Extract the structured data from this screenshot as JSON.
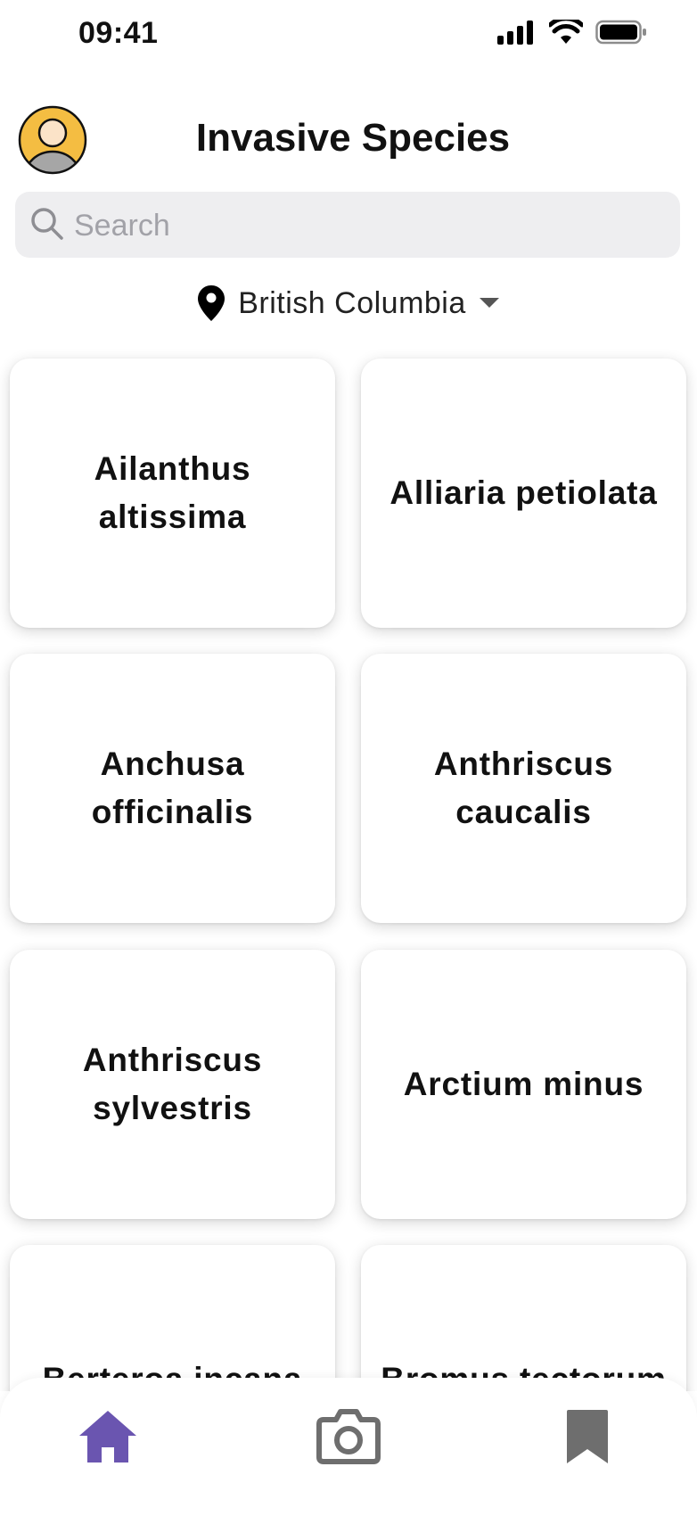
{
  "status_bar": {
    "time": "09:41"
  },
  "header": {
    "title": "Invasive Species"
  },
  "search": {
    "placeholder": "Search",
    "value": ""
  },
  "region": {
    "selected": "British Columbia"
  },
  "species": [
    {
      "name": "Ailanthus altissima"
    },
    {
      "name": "Alliaria petiolata"
    },
    {
      "name": "Anchusa officinalis"
    },
    {
      "name": "Anthriscus caucalis"
    },
    {
      "name": "Anthriscus sylvestris"
    },
    {
      "name": "Arctium minus"
    },
    {
      "name": "Berteroa incana"
    },
    {
      "name": "Bromus tectorum"
    }
  ],
  "tab_bar": {
    "active_tab": "home",
    "active_color": "#6a55b0",
    "inactive_color": "#6e6e6e",
    "icons": [
      "home-icon",
      "camera-icon",
      "bookmark-icon"
    ]
  },
  "colors": {
    "avatar_background": "#f4bd42",
    "search_background": "#eeeef0"
  }
}
